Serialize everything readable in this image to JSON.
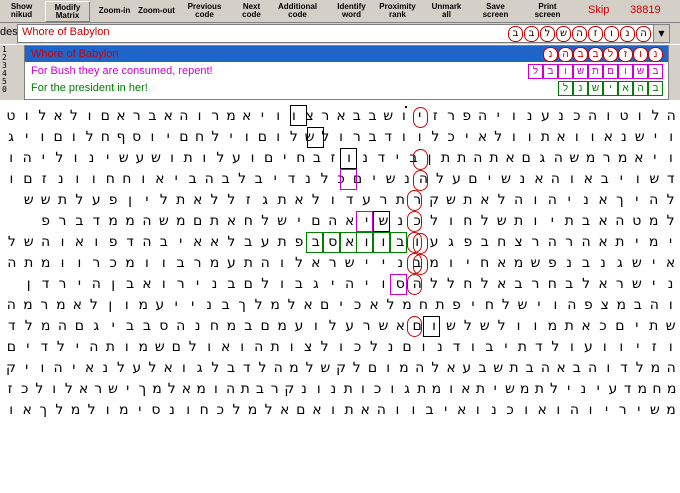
{
  "toolbar": {
    "buttons": [
      {
        "name": "show-nikud-button",
        "label": "Show\nnikud"
      },
      {
        "name": "modify-matrix-button",
        "label": "Modify\nMatrix"
      },
      {
        "name": "zoom-in-button",
        "label": "Zoom-in"
      },
      {
        "name": "zoom-out-button",
        "label": "Zoom-out"
      },
      {
        "name": "previous-code-button",
        "label": "Previous\ncode"
      },
      {
        "name": "next-code-button",
        "label": "Next\ncode"
      },
      {
        "name": "additional-code-button",
        "label": "Additional\ncode"
      },
      {
        "name": "identify-word-button",
        "label": "Identify\nword"
      },
      {
        "name": "proximity-rank-button",
        "label": "Proximity\nrank"
      },
      {
        "name": "unmark-all-button",
        "label": "Unmark\nall"
      },
      {
        "name": "save-screen-button",
        "label": "Save\nscreen"
      },
      {
        "name": "print-screen-button",
        "label": "Print\nscreen"
      }
    ],
    "skip_label": "Skip",
    "skip_value": "38819"
  },
  "codebar": {
    "codes_label": "des :",
    "selected_code": "Whore of Babylon",
    "selected_letters": [
      "ב",
      "ב",
      "ל",
      "ש",
      "ה",
      "ז",
      "ו",
      "נ",
      "ה"
    ]
  },
  "code_list": {
    "row_numbers": [
      "1",
      "2",
      "3",
      "4",
      "5",
      "0"
    ],
    "items": [
      {
        "label": "Whore of Babylon",
        "color": "#cc0000",
        "selected": true,
        "letters": [
          "נ",
          "ה",
          "ב",
          "ב",
          "ל",
          "ז",
          "ו",
          "נ"
        ],
        "letter_color": "#cc0000"
      },
      {
        "label": "For Bush they are consumed, repent!",
        "color": "#cc00cc",
        "selected": false,
        "letters": [
          "ל",
          "ב",
          "ו",
          "ש",
          "ת",
          "ם",
          "ו",
          "ש",
          "ב"
        ],
        "letter_color": "#cc00cc"
      },
      {
        "label": "For the president in her!",
        "color": "#008000",
        "selected": false,
        "letters": [
          "ל",
          "נ",
          "ש",
          "י",
          "א",
          "ה",
          "ב"
        ],
        "letter_color": "#008000"
      }
    ]
  },
  "grid": {
    "rows": [
      "הלוטוהכנענויהפרזיושבבארצוויאמרוהאבראםולאלוט",
      "וישנאוואתוולאיכלוודברולשלוםוילחםיוסףחלוםויג",
      "ויאמרמשהגםאתהתתןבידנוזבחיםועלותושעשינוליהו",
      "דשויבאוהאנשיםעלהנשיםכלנדיבלבהביאוחחוונזםו",
      "להיךאניהוהלאתשקרתרעדולאתגזללאתליןפעלתשש",
      "למטהאבתיותשלחולכנשיאהםישלחאתםמשהממדברפ",
      "ימיתאהרהרצחבפגעובוואסבפתעבלאאיבהדפואוהשל",
      "אישגנבנפשמאחיומבניישראלוהתעמרבוומכרוומתה",
      "נישראלבחרבאלחללהסויהיגבולםבנירואבןהירדן",
      "והבמצפהוישלחיפתחמלאכיםאלמלךבנייעמוןלאמרמה",
      "שתיםכאתמוולשלשוםאשרעלועמםבמחנהסבביגםהמלד",
      "וזיוועולדתיבודנוםנלכולצותהואולםשמותהילדים",
      "המלדוהבאהבתשבעאלהמוםלקשלמהלדבלגואלעלנאיהויק",
      "מחמדעינילתמשיתאומתגוכותנונקרבתהומאלמךישראלולכז",
      "משיריוהואוכנואיבווהאתואםאלמלכחונסימולמלךאו"
    ]
  }
}
